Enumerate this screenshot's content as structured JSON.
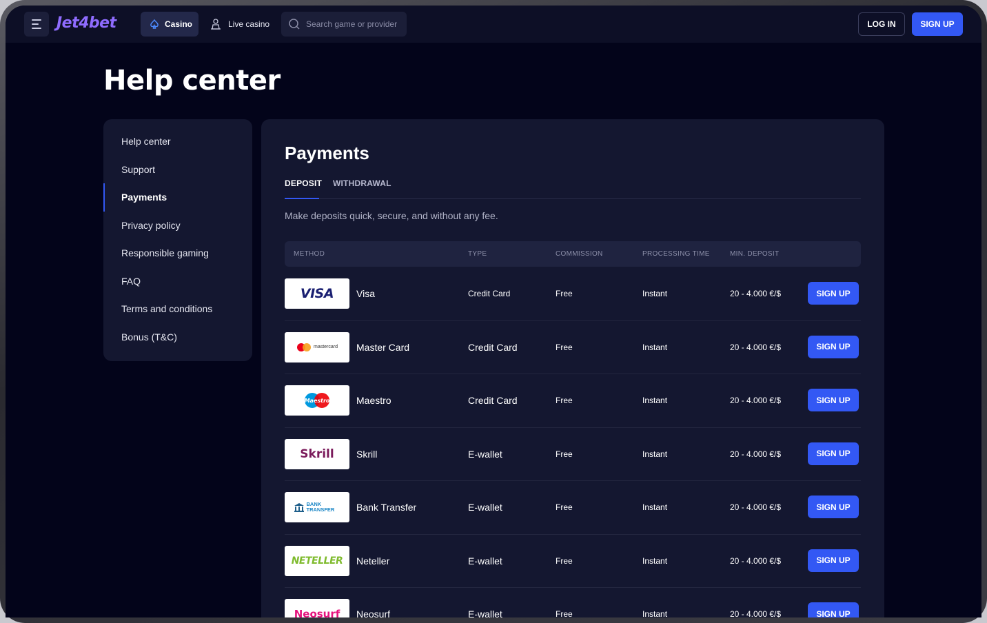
{
  "header": {
    "logo_text": "Jet4bet",
    "nav": {
      "casino_label": "Casino",
      "live_casino_label": "Live casino"
    },
    "search": {
      "placeholder": "Search game or provider"
    },
    "login_label": "LOG IN",
    "signup_label": "SIGN UP",
    "accent_color": "#3358f4"
  },
  "page_title": "Help center",
  "sidebar": {
    "items": [
      {
        "label": "Help center",
        "active": false
      },
      {
        "label": "Support",
        "active": false
      },
      {
        "label": "Payments",
        "active": true
      },
      {
        "label": "Privacy policy",
        "active": false
      },
      {
        "label": "Responsible gaming",
        "active": false
      },
      {
        "label": "FAQ",
        "active": false
      },
      {
        "label": "Terms and conditions",
        "active": false
      },
      {
        "label": "Bonus (T&C)",
        "active": false
      }
    ]
  },
  "main": {
    "title": "Payments",
    "tabs": [
      {
        "label": "DEPOSIT",
        "active": true
      },
      {
        "label": "WITHDRAWAL",
        "active": false
      }
    ],
    "description": "Make deposits quick, secure, and without any fee.",
    "columns": [
      "METHOD",
      "TYPE",
      "COMMISSION",
      "PROCESSING TIME",
      "MIN. DEPOSIT"
    ],
    "rows": [
      {
        "logo": "VISA",
        "method": "Visa",
        "type": "Credit Card",
        "commission": "Free",
        "processing": "Instant",
        "min_deposit": "20 - 4.000 €/$",
        "button": "SIGN UP"
      },
      {
        "logo": "mastercard",
        "method": "Master Card",
        "type": "Credit Card",
        "commission": "Free",
        "processing": "Instant",
        "min_deposit": "20 - 4.000 €/$",
        "button": "SIGN UP"
      },
      {
        "logo": "Maestro",
        "method": "Maestro",
        "type": "Credit Card",
        "commission": "Free",
        "processing": "Instant",
        "min_deposit": "20 - 4.000 €/$",
        "button": "SIGN UP"
      },
      {
        "logo": "Skrill",
        "method": "Skrill",
        "type": "E-wallet",
        "commission": "Free",
        "processing": "Instant",
        "min_deposit": "20 - 4.000 €/$",
        "button": "SIGN UP"
      },
      {
        "logo": "BANK TRANSFER",
        "method": "Bank Transfer",
        "type": "E-wallet",
        "commission": "Free",
        "processing": "Instant",
        "min_deposit": "20 - 4.000 €/$",
        "button": "SIGN UP"
      },
      {
        "logo": "NETELLER",
        "method": "Neteller",
        "type": "E-wallet",
        "commission": "Free",
        "processing": "Instant",
        "min_deposit": "20 - 4.000 €/$",
        "button": "SIGN UP"
      },
      {
        "logo": "Neosurf",
        "method": "Neosurf",
        "type": "E-wallet",
        "commission": "Free",
        "processing": "Instant",
        "min_deposit": "20 - 4.000 €/$",
        "button": "SIGN UP"
      }
    ]
  }
}
